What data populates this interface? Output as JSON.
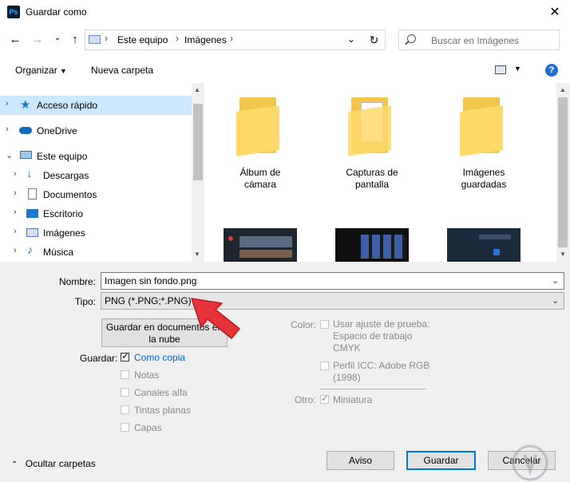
{
  "window": {
    "title": "Guardar como",
    "app_icon": "Ps",
    "close_glyph": "✕"
  },
  "nav": {
    "back": "←",
    "forward": "→",
    "recent": "⌄",
    "up": "↑",
    "breadcrumbs": [
      "Este equipo",
      "Imágenes"
    ],
    "crumb_sep": "›",
    "refresh": "↻",
    "search_placeholder": "Buscar en Imágenes"
  },
  "toolbar": {
    "organize_label": "Organizar",
    "new_folder_label": "Nueva carpeta",
    "help": "?"
  },
  "sidebar": {
    "items": [
      {
        "label": "Acceso rápido",
        "icon": "star-icon",
        "selected": true
      },
      {
        "label": "OneDrive",
        "icon": "cloud-icon"
      },
      {
        "label": "Este equipo",
        "icon": "computer-icon",
        "expanded": true
      },
      {
        "label": "Descargas",
        "icon": "download-icon"
      },
      {
        "label": "Documentos",
        "icon": "document-icon"
      },
      {
        "label": "Escritorio",
        "icon": "desktop-icon"
      },
      {
        "label": "Imágenes",
        "icon": "pictures-icon"
      },
      {
        "label": "Música",
        "icon": "music-icon"
      }
    ]
  },
  "files": {
    "folders": [
      {
        "line1": "Álbum de",
        "line2": "cámara"
      },
      {
        "line1": "Capturas de",
        "line2": "pantalla"
      },
      {
        "line1": "Imágenes",
        "line2": "guardadas"
      }
    ]
  },
  "form": {
    "name_label": "Nombre:",
    "name_value": "Imagen sin fondo.png",
    "type_label": "Tipo:",
    "type_value": "PNG (*.PNG;*.PNG)",
    "cloud_button_line1": "Guardar en documentos en",
    "cloud_button_line2": "la nube",
    "guardar_label": "Guardar:",
    "options": [
      {
        "label": "Como copia",
        "checked": true,
        "enabled": true
      },
      {
        "label": "Notas",
        "checked": false,
        "enabled": false
      },
      {
        "label": "Canales alfa",
        "checked": false,
        "enabled": false
      },
      {
        "label": "Tintas planas",
        "checked": false,
        "enabled": false
      },
      {
        "label": "Capas",
        "checked": false,
        "enabled": false
      }
    ],
    "color_label": "Color:",
    "proof_line1": "Usar ajuste de prueba:",
    "proof_line2": "Espacio de trabajo",
    "proof_line3": "CMYK",
    "icc_line1": "Perfil ICC: Adobe RGB",
    "icc_line2": "(1998)",
    "otro_label": "Otro:",
    "thumbnail_label": "Miniatura"
  },
  "footer": {
    "hide_folders": "Ocultar carpetas",
    "aviso": "Aviso",
    "guardar": "Guardar",
    "cancelar": "Cancelar"
  },
  "colors": {
    "accent": "#0078d7",
    "selected_bg": "#cce8ff",
    "folder": "#ffd96a",
    "arrow": "#e63339"
  }
}
